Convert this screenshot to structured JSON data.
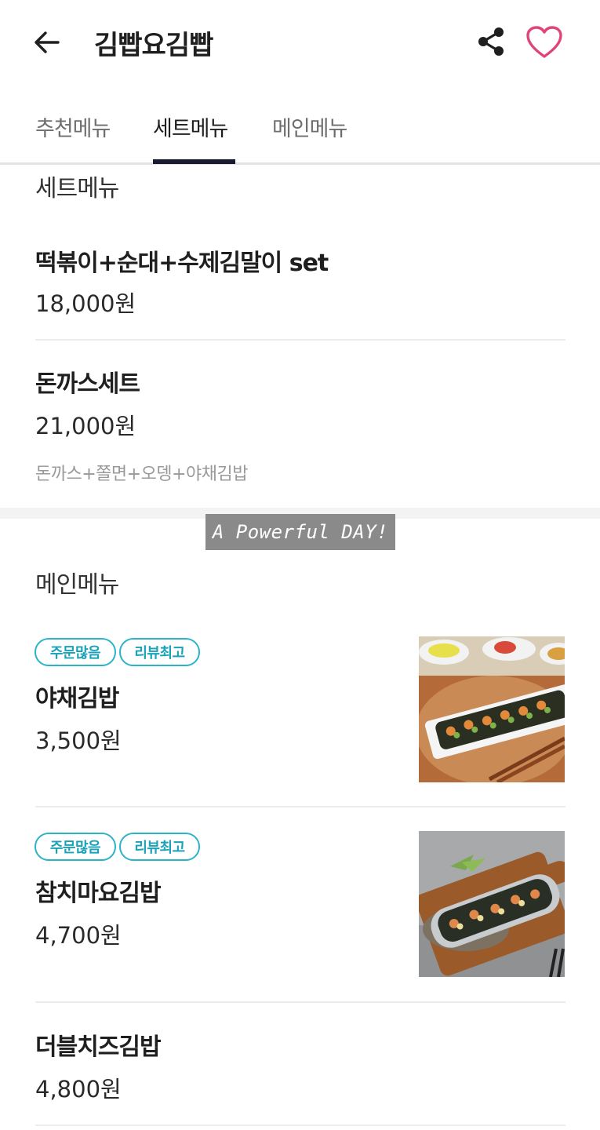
{
  "header": {
    "title": "김빱요김빱",
    "icons": [
      "back-arrow-icon",
      "share-icon",
      "heart-icon"
    ]
  },
  "tabs": [
    {
      "label": "추천메뉴",
      "active": false
    },
    {
      "label": "세트메뉴",
      "active": true
    },
    {
      "label": "메인메뉴",
      "active": false
    }
  ],
  "set_section": {
    "title": "세트메뉴",
    "items": [
      {
        "name": "떡볶이+순대+수제김말이 set",
        "price": "18,000원"
      },
      {
        "name": "돈까스세트",
        "price": "21,000원",
        "description": "돈까스+쫄면+오뎅+야채김밥"
      }
    ]
  },
  "watermark": "A Powerful DAY!",
  "main_section": {
    "title": "메인메뉴",
    "items": [
      {
        "badges": [
          "주문많음",
          "리뷰최고"
        ],
        "name": "야채김밥",
        "price": "3,500원"
      },
      {
        "badges": [
          "주문많음",
          "리뷰최고"
        ],
        "name": "참치마요김밥",
        "price": "4,700원"
      },
      {
        "name": "더블치즈김밥",
        "price": "4,800원"
      }
    ]
  },
  "colors": {
    "accent_tab": "#1b1a33",
    "heart": "#e0447a",
    "badge": "#2bb3c9"
  }
}
